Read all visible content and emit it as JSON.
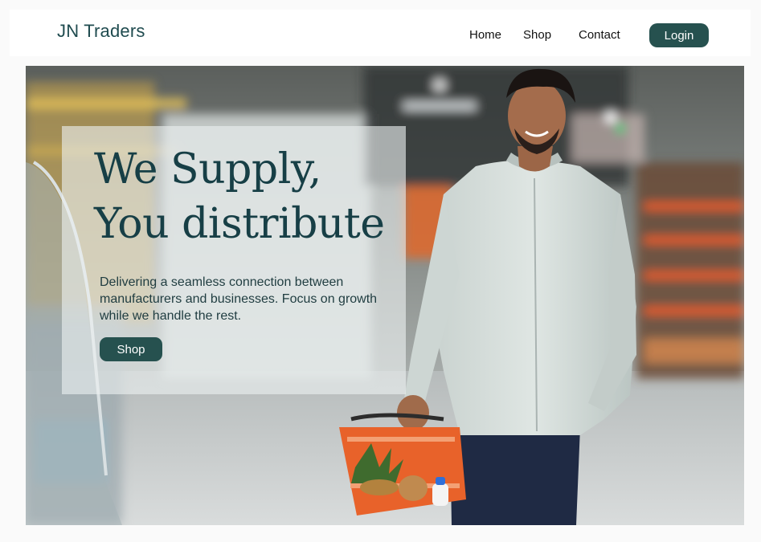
{
  "header": {
    "brand": "JN Traders",
    "nav": {
      "home": "Home",
      "shop": "Shop",
      "contact": "Contact"
    },
    "login_label": "Login"
  },
  "hero": {
    "headline_line1": "We Supply,",
    "headline_line2": "You distribute",
    "subtext": "Delivering a seamless connection between manufacturers and businesses. Focus on growth while we handle the rest.",
    "cta_label": "Shop",
    "image": "supermarket-shopper-photo"
  },
  "colors": {
    "accent": "#26514f",
    "headline": "#173f46",
    "basket": "#e8622a"
  }
}
